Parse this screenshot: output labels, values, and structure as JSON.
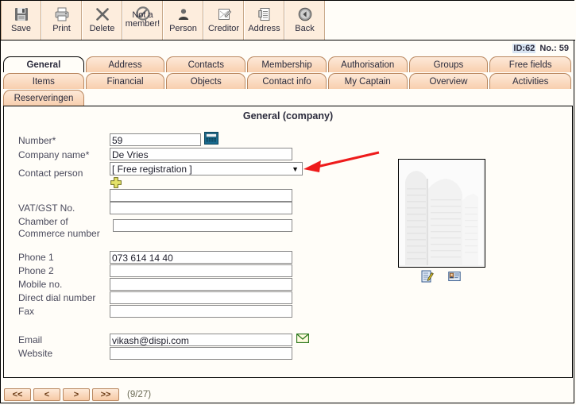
{
  "toolbar": {
    "buttons": [
      {
        "label": "Save",
        "icon": "floppy-disk-icon",
        "name": "save"
      },
      {
        "label": "Print",
        "icon": "printer-icon",
        "name": "print"
      },
      {
        "label": "Delete",
        "icon": "x-cross-icon",
        "name": "delete"
      },
      {
        "label": "Not a member!",
        "icon": "no-entry-icon",
        "name": "not-a-member"
      },
      {
        "label": "Person",
        "icon": "person-icon",
        "name": "person"
      },
      {
        "label": "Creditor",
        "icon": "checklist-icon",
        "name": "creditor"
      },
      {
        "label": "Address",
        "icon": "address-card-icon",
        "name": "address"
      },
      {
        "label": "Back",
        "icon": "back-arrow-icon",
        "name": "back"
      }
    ]
  },
  "header": {
    "id_label": "ID:62",
    "number_label": "No.: 59"
  },
  "tabs": {
    "row1": [
      {
        "label": "General",
        "active": true
      },
      {
        "label": "Address",
        "active": false
      },
      {
        "label": "Contacts",
        "active": false
      },
      {
        "label": "Membership",
        "active": false
      },
      {
        "label": "Authorisation",
        "active": false
      },
      {
        "label": "Groups",
        "active": false
      },
      {
        "label": "Free fields",
        "active": false
      }
    ],
    "row2": [
      {
        "label": "Items",
        "active": false
      },
      {
        "label": "Financial",
        "active": false
      },
      {
        "label": "Objects",
        "active": false
      },
      {
        "label": "Contact info",
        "active": false
      },
      {
        "label": "My Captain",
        "active": false
      },
      {
        "label": "Overview",
        "active": false
      },
      {
        "label": "Activities",
        "active": false
      }
    ],
    "row3": [
      {
        "label": "Reserveringen",
        "active": false
      }
    ]
  },
  "panel": {
    "title": "General (company)",
    "fields": {
      "number": {
        "label": "Number*",
        "value": "59"
      },
      "company_name": {
        "label": "Company name*",
        "value": "De Vries"
      },
      "contact_person": {
        "label": "Contact person",
        "value": "[ Free registration ]"
      },
      "blank_under_contact": {
        "label": "",
        "value": ""
      },
      "vat": {
        "label": "VAT/GST No.",
        "value": ""
      },
      "chamber_line1": {
        "label": "Chamber of"
      },
      "chamber_line2": {
        "label": "Commerce number"
      },
      "chamber": {
        "value": ""
      },
      "phone1": {
        "label": "Phone 1",
        "value": "073  614 14 40"
      },
      "phone2": {
        "label": "Phone 2",
        "value": ""
      },
      "mobile": {
        "label": "Mobile no.",
        "value": ""
      },
      "direct_dial": {
        "label": "Direct dial number",
        "value": ""
      },
      "fax": {
        "label": "Fax",
        "value": ""
      },
      "email": {
        "label": "Email",
        "value": "vikash@dispi.com"
      },
      "website": {
        "label": "Website",
        "value": ""
      }
    },
    "icons": {
      "calculator": "calculator-icon",
      "add": "add-plus-icon",
      "mail": "envelope-icon",
      "edit_photo": "edit-note-icon",
      "photo_card": "id-card-icon"
    },
    "photo": {
      "alt": "company-building-photo"
    },
    "annotation": {
      "type": "red-arrow",
      "points_to": "contact-person-dropdown"
    }
  },
  "footer": {
    "first_label": "<<",
    "prev_label": "<",
    "next_label": ">",
    "last_label": ">>",
    "counter": "(9/27)"
  },
  "colors": {
    "tab": "#fbdcc2",
    "tab_border": "#b9875f",
    "page_bg": "#fffdf8",
    "accent_red": "#ee1b1b",
    "id_highlight": "#d8e4f2"
  }
}
